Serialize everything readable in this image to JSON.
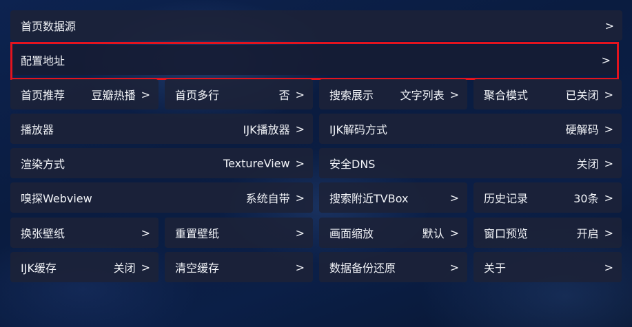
{
  "settings": {
    "home_source": {
      "label": "首页数据源",
      "arrow": ">"
    },
    "config_url": {
      "label": "配置地址",
      "arrow": ">"
    },
    "home_recommend": {
      "label": "首页推荐",
      "value": "豆瓣热播",
      "arrow": ">"
    },
    "home_multirow": {
      "label": "首页多行",
      "value": "否",
      "arrow": ">"
    },
    "search_display": {
      "label": "搜索展示",
      "value": "文字列表",
      "arrow": ">"
    },
    "aggregate_mode": {
      "label": "聚合模式",
      "value": "已关闭",
      "arrow": ">"
    },
    "player": {
      "label": "播放器",
      "value": "IJK播放器",
      "arrow": ">"
    },
    "ijk_decode": {
      "label": "IJK解码方式",
      "value": "硬解码",
      "arrow": ">"
    },
    "render_mode": {
      "label": "渲染方式",
      "value": "TextureView",
      "arrow": ">"
    },
    "secure_dns": {
      "label": "安全DNS",
      "value": "关闭",
      "arrow": ">"
    },
    "sniff_webview": {
      "label": "嗅探Webview",
      "value": "系统自带",
      "arrow": ">"
    },
    "search_nearby": {
      "label": "搜索附近TVBox",
      "arrow": ">"
    },
    "history": {
      "label": "历史记录",
      "value": "30条",
      "arrow": ">"
    },
    "change_wallpaper": {
      "label": "换张壁纸",
      "arrow": ">"
    },
    "reset_wallpaper": {
      "label": "重置壁纸",
      "arrow": ">"
    },
    "picture_scale": {
      "label": "画面缩放",
      "value": "默认",
      "arrow": ">"
    },
    "window_preview": {
      "label": "窗口预览",
      "value": "开启",
      "arrow": ">"
    },
    "ijk_cache": {
      "label": "IJK缓存",
      "value": "关闭",
      "arrow": ">"
    },
    "clear_cache": {
      "label": "清空缓存",
      "arrow": ">"
    },
    "backup_restore": {
      "label": "数据备份还原",
      "arrow": ">"
    },
    "about": {
      "label": "关于",
      "arrow": ">"
    }
  },
  "colors": {
    "focus_border": "#e3141e",
    "item_background": "#1c2238"
  }
}
